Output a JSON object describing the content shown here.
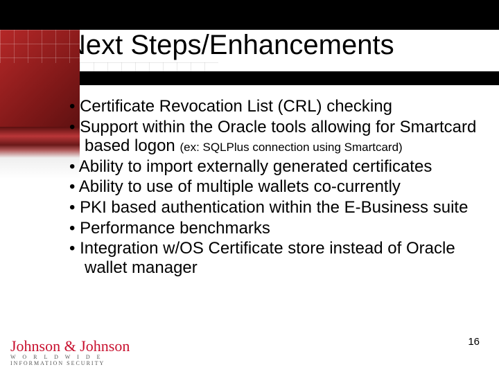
{
  "title": "Next Steps/Enhancements",
  "bullets": [
    {
      "main": "Certificate Revocation List (CRL) checking",
      "small": ""
    },
    {
      "main": "Support within the Oracle tools allowing for Smartcard based logon ",
      "small": "(ex: SQLPlus connection using Smartcard)"
    },
    {
      "main": "Ability to import externally generated certificates",
      "small": ""
    },
    {
      "main": "Ability to use of multiple wallets co-currently",
      "small": ""
    },
    {
      "main": "PKI based authentication within the E-Business suite",
      "small": ""
    },
    {
      "main": "Performance benchmarks",
      "small": ""
    },
    {
      "main": "Integration w/OS Certificate store instead of Oracle wallet manager",
      "small": ""
    }
  ],
  "footer": {
    "brand": "Johnson & Johnson",
    "line1": "W O R L D W I D E",
    "line2": "INFORMATION SECURITY"
  },
  "page_number": "16"
}
